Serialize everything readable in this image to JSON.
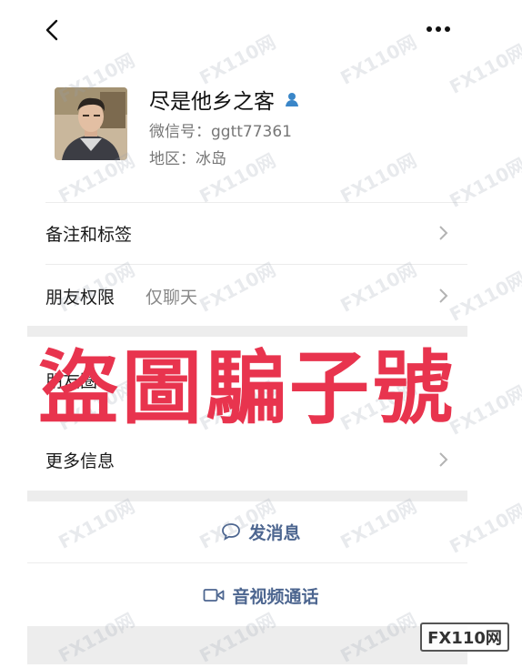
{
  "profile": {
    "name": "尽是他乡之客",
    "wechat_id": "微信号：ggtt77361",
    "region": "地区：冰岛"
  },
  "rows": {
    "remarks": {
      "label": "备注和标签"
    },
    "permissions": {
      "label": "朋友权限",
      "value": "仅聊天"
    },
    "moments": {
      "label": "朋友圈"
    },
    "more_info": {
      "label": "更多信息"
    }
  },
  "actions": {
    "message": {
      "label": "发消息",
      "icon": "chat-bubble-icon"
    },
    "call": {
      "label": "音视频通话",
      "icon": "video-icon"
    }
  },
  "stamp": {
    "text": "盜圖騙子號",
    "color": "#e8344e"
  },
  "watermark": {
    "text": "FX110网"
  },
  "colors": {
    "accent": "#4d6690",
    "gender": "#3a86c8"
  }
}
